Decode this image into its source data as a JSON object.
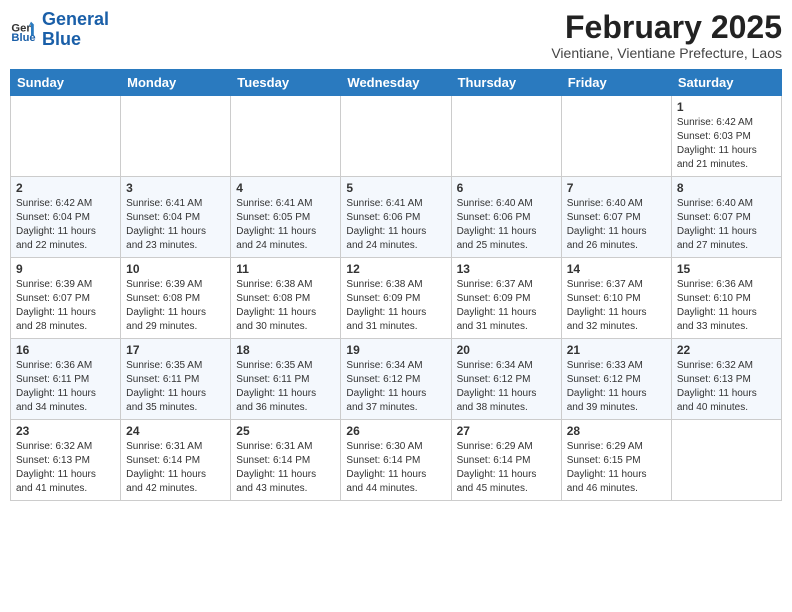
{
  "header": {
    "logo_line1": "General",
    "logo_line2": "Blue",
    "month_title": "February 2025",
    "location": "Vientiane, Vientiane Prefecture, Laos"
  },
  "weekdays": [
    "Sunday",
    "Monday",
    "Tuesday",
    "Wednesday",
    "Thursday",
    "Friday",
    "Saturday"
  ],
  "weeks": [
    [
      {
        "day": "",
        "info": ""
      },
      {
        "day": "",
        "info": ""
      },
      {
        "day": "",
        "info": ""
      },
      {
        "day": "",
        "info": ""
      },
      {
        "day": "",
        "info": ""
      },
      {
        "day": "",
        "info": ""
      },
      {
        "day": "1",
        "info": "Sunrise: 6:42 AM\nSunset: 6:03 PM\nDaylight: 11 hours\nand 21 minutes."
      }
    ],
    [
      {
        "day": "2",
        "info": "Sunrise: 6:42 AM\nSunset: 6:04 PM\nDaylight: 11 hours\nand 22 minutes."
      },
      {
        "day": "3",
        "info": "Sunrise: 6:41 AM\nSunset: 6:04 PM\nDaylight: 11 hours\nand 23 minutes."
      },
      {
        "day": "4",
        "info": "Sunrise: 6:41 AM\nSunset: 6:05 PM\nDaylight: 11 hours\nand 24 minutes."
      },
      {
        "day": "5",
        "info": "Sunrise: 6:41 AM\nSunset: 6:06 PM\nDaylight: 11 hours\nand 24 minutes."
      },
      {
        "day": "6",
        "info": "Sunrise: 6:40 AM\nSunset: 6:06 PM\nDaylight: 11 hours\nand 25 minutes."
      },
      {
        "day": "7",
        "info": "Sunrise: 6:40 AM\nSunset: 6:07 PM\nDaylight: 11 hours\nand 26 minutes."
      },
      {
        "day": "8",
        "info": "Sunrise: 6:40 AM\nSunset: 6:07 PM\nDaylight: 11 hours\nand 27 minutes."
      }
    ],
    [
      {
        "day": "9",
        "info": "Sunrise: 6:39 AM\nSunset: 6:07 PM\nDaylight: 11 hours\nand 28 minutes."
      },
      {
        "day": "10",
        "info": "Sunrise: 6:39 AM\nSunset: 6:08 PM\nDaylight: 11 hours\nand 29 minutes."
      },
      {
        "day": "11",
        "info": "Sunrise: 6:38 AM\nSunset: 6:08 PM\nDaylight: 11 hours\nand 30 minutes."
      },
      {
        "day": "12",
        "info": "Sunrise: 6:38 AM\nSunset: 6:09 PM\nDaylight: 11 hours\nand 31 minutes."
      },
      {
        "day": "13",
        "info": "Sunrise: 6:37 AM\nSunset: 6:09 PM\nDaylight: 11 hours\nand 31 minutes."
      },
      {
        "day": "14",
        "info": "Sunrise: 6:37 AM\nSunset: 6:10 PM\nDaylight: 11 hours\nand 32 minutes."
      },
      {
        "day": "15",
        "info": "Sunrise: 6:36 AM\nSunset: 6:10 PM\nDaylight: 11 hours\nand 33 minutes."
      }
    ],
    [
      {
        "day": "16",
        "info": "Sunrise: 6:36 AM\nSunset: 6:11 PM\nDaylight: 11 hours\nand 34 minutes."
      },
      {
        "day": "17",
        "info": "Sunrise: 6:35 AM\nSunset: 6:11 PM\nDaylight: 11 hours\nand 35 minutes."
      },
      {
        "day": "18",
        "info": "Sunrise: 6:35 AM\nSunset: 6:11 PM\nDaylight: 11 hours\nand 36 minutes."
      },
      {
        "day": "19",
        "info": "Sunrise: 6:34 AM\nSunset: 6:12 PM\nDaylight: 11 hours\nand 37 minutes."
      },
      {
        "day": "20",
        "info": "Sunrise: 6:34 AM\nSunset: 6:12 PM\nDaylight: 11 hours\nand 38 minutes."
      },
      {
        "day": "21",
        "info": "Sunrise: 6:33 AM\nSunset: 6:12 PM\nDaylight: 11 hours\nand 39 minutes."
      },
      {
        "day": "22",
        "info": "Sunrise: 6:32 AM\nSunset: 6:13 PM\nDaylight: 11 hours\nand 40 minutes."
      }
    ],
    [
      {
        "day": "23",
        "info": "Sunrise: 6:32 AM\nSunset: 6:13 PM\nDaylight: 11 hours\nand 41 minutes."
      },
      {
        "day": "24",
        "info": "Sunrise: 6:31 AM\nSunset: 6:14 PM\nDaylight: 11 hours\nand 42 minutes."
      },
      {
        "day": "25",
        "info": "Sunrise: 6:31 AM\nSunset: 6:14 PM\nDaylight: 11 hours\nand 43 minutes."
      },
      {
        "day": "26",
        "info": "Sunrise: 6:30 AM\nSunset: 6:14 PM\nDaylight: 11 hours\nand 44 minutes."
      },
      {
        "day": "27",
        "info": "Sunrise: 6:29 AM\nSunset: 6:14 PM\nDaylight: 11 hours\nand 45 minutes."
      },
      {
        "day": "28",
        "info": "Sunrise: 6:29 AM\nSunset: 6:15 PM\nDaylight: 11 hours\nand 46 minutes."
      },
      {
        "day": "",
        "info": ""
      }
    ]
  ]
}
